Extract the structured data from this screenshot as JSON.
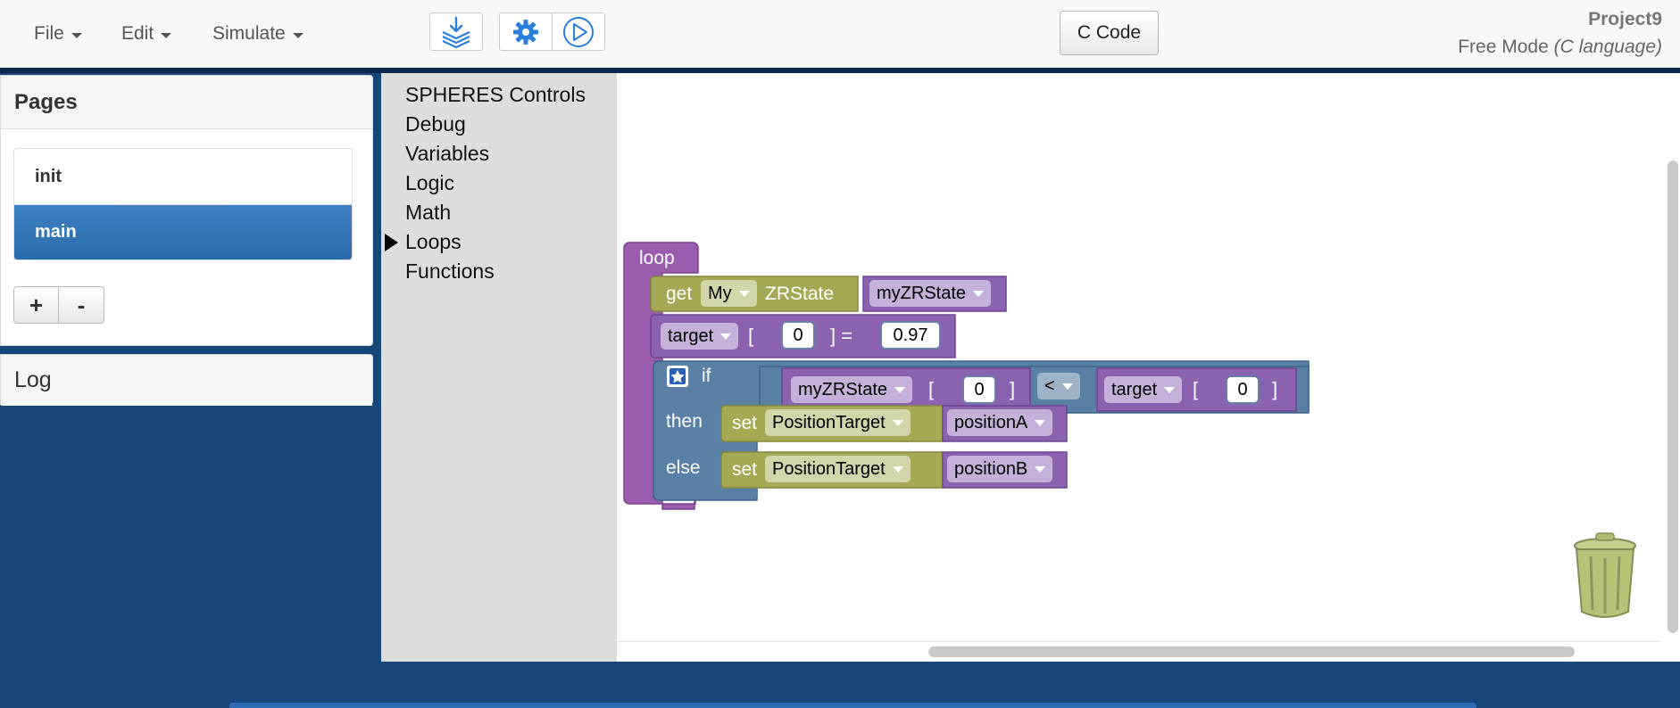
{
  "menu": {
    "file": "File",
    "edit": "Edit",
    "simulate": "Simulate"
  },
  "toolbar": {
    "ccode_label": "C Code"
  },
  "project": {
    "name": "Project9",
    "mode_prefix": "Free Mode ",
    "mode_lang": "(C language)"
  },
  "pages_panel": {
    "title": "Pages",
    "items": [
      {
        "label": "init",
        "active": false
      },
      {
        "label": "main",
        "active": true
      }
    ],
    "add_label": "+",
    "remove_label": "-"
  },
  "log_panel": {
    "title": "Log"
  },
  "toolbox": {
    "items": [
      {
        "label": "SPHERES Controls"
      },
      {
        "label": "Debug"
      },
      {
        "label": "Variables"
      },
      {
        "label": "Logic"
      },
      {
        "label": "Math"
      },
      {
        "label": "Loops",
        "selected": true
      },
      {
        "label": "Functions"
      }
    ]
  },
  "blocks": {
    "loop": "loop",
    "get": "get",
    "my": "My",
    "zrstate": "ZRState",
    "myzrstate_var": "myZRState",
    "target_var": "target",
    "open_bracket": "[",
    "close_bracket": "]",
    "close_eq": "] =",
    "index0": "0",
    "value": "0.97",
    "if_label": "if",
    "then_label": "then",
    "else_label": "else",
    "cond_var": "myZRState",
    "cond_index": "0",
    "operator": "<",
    "cond_target": "target",
    "cond_target_index": "0",
    "set": "set",
    "position_target": "PositionTarget",
    "position_a": "positionA",
    "position_b": "positionB"
  },
  "colors": {
    "nav_bg": "#f8f8f8",
    "app_bg": "#16467a",
    "loop_block": "#9a5cac",
    "variable_block": "#8a62b0",
    "get_set_block": "#a5a954",
    "if_block": "#5b80a5",
    "active_page": "#337ab7"
  }
}
